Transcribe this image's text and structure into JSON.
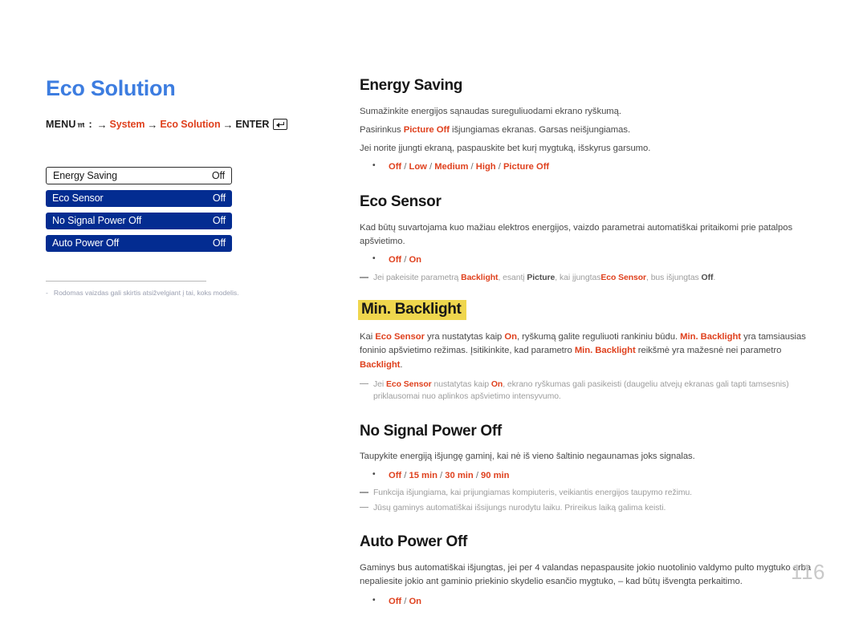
{
  "page": {
    "title": "Eco Solution",
    "number": "116"
  },
  "breadcrumb": {
    "menu_label": "MENU",
    "menu_icon": "menu-m-glyph",
    "colon": ":",
    "arrow": "→",
    "step1": "System",
    "step2": "Eco Solution",
    "enter_label": "ENTER",
    "enter_icon": "enter-key-icon"
  },
  "osd": {
    "rows": [
      {
        "label": "Energy Saving",
        "value": "Off",
        "selected": true
      },
      {
        "label": "Eco Sensor",
        "value": "Off",
        "selected": false
      },
      {
        "label": "No Signal Power Off",
        "value": "Off",
        "selected": false
      },
      {
        "label": "Auto Power Off",
        "value": "Off",
        "selected": false
      }
    ],
    "footnote_dash": "-",
    "footnote": "Rodomas vaizdas gali skirtis atsižvelgiant į tai, koks modelis."
  },
  "sections": {
    "energy_saving": {
      "title": "Energy Saving",
      "p1": "Sumažinkite energijos sąnaudas sureguliuodami ekrano ryškumą.",
      "p2_a": "Pasirinkus ",
      "p2_accent": "Picture Off",
      "p2_b": " išjungiamas ekranas. Garsas neišjungiamas.",
      "p3": "Jei norite įjungti ekraną, paspauskite bet kurį mygtuką, išskyrus garsumo.",
      "options": [
        "Off",
        "Low",
        "Medium",
        "High",
        "Picture Off"
      ]
    },
    "eco_sensor": {
      "title": "Eco Sensor",
      "p1": "Kad būtų suvartojama kuo mažiau elektros energijos, vaizdo parametrai automatiškai pritaikomi prie patalpos apšvietimo.",
      "options": [
        "Off",
        "On"
      ],
      "note_a": "Jei pakeisite parametrą ",
      "note_b1": "Backlight",
      "note_b": ", esantį ",
      "note_b2": "Picture",
      "note_c": ", kai įjungtas",
      "note_b3": "Eco Sensor",
      "note_d": ", bus išjungtas ",
      "note_b4": "Off",
      "note_e": "."
    },
    "min_backlight": {
      "title": "Min. Backlight",
      "p1_a": "Kai ",
      "p1_b1": "Eco Sensor",
      "p1_b": " yra nustatytas kaip ",
      "p1_b2": "On",
      "p1_c": ", ryškumą galite reguliuoti rankiniu būdu. ",
      "p1_b3": "Min. Backlight",
      "p1_d": " yra tamsiausias foninio apšvietimo režimas. Įsitikinkite, kad parametro ",
      "p1_b4": "Min. Backlight",
      "p1_e": " reikšmė yra mažesnė nei parametro ",
      "p1_b5": "Backlight",
      "p1_f": ".",
      "note_a": "Jei ",
      "note_b1": "Eco Sensor",
      "note_b": " nustatytas kaip ",
      "note_b2": "On",
      "note_c": ", ekrano ryškumas gali pasikeisti (daugeliu atvejų ekranas gali tapti tamsesnis) priklausomai nuo aplinkos apšvietimo intensyvumo."
    },
    "no_signal_power_off": {
      "title": "No Signal Power Off",
      "p1": "Taupykite energiją išjungę gaminį, kai nė iš vieno šaltinio negaunamas joks signalas.",
      "options": [
        "Off",
        "15 min",
        "30 min",
        "90 min"
      ],
      "note1": "Funkcija išjungiama, kai prijungiamas kompiuteris, veikiantis energijos taupymo režimu.",
      "note2": "Jūsų gaminys automatiškai išsijungs nurodytu laiku. Prireikus laiką galima keisti."
    },
    "auto_power_off": {
      "title": "Auto Power Off",
      "p1": "Gaminys bus automatiškai išjungtas, jei per 4 valandas nepaspausite jokio nuotolinio valdymo pulto mygtuko arba nepaliesite jokio ant gaminio priekinio skydelio esančio mygtuko, – kad būtų išvengta perkaitimo.",
      "options": [
        "Off",
        "On"
      ]
    }
  },
  "colors": {
    "title_blue": "#3d7de0",
    "osd_blue": "#032c91",
    "accent_red": "#df411e",
    "highlight_yellow": "#efd64d",
    "page_number_gray": "#c9c9c9"
  }
}
